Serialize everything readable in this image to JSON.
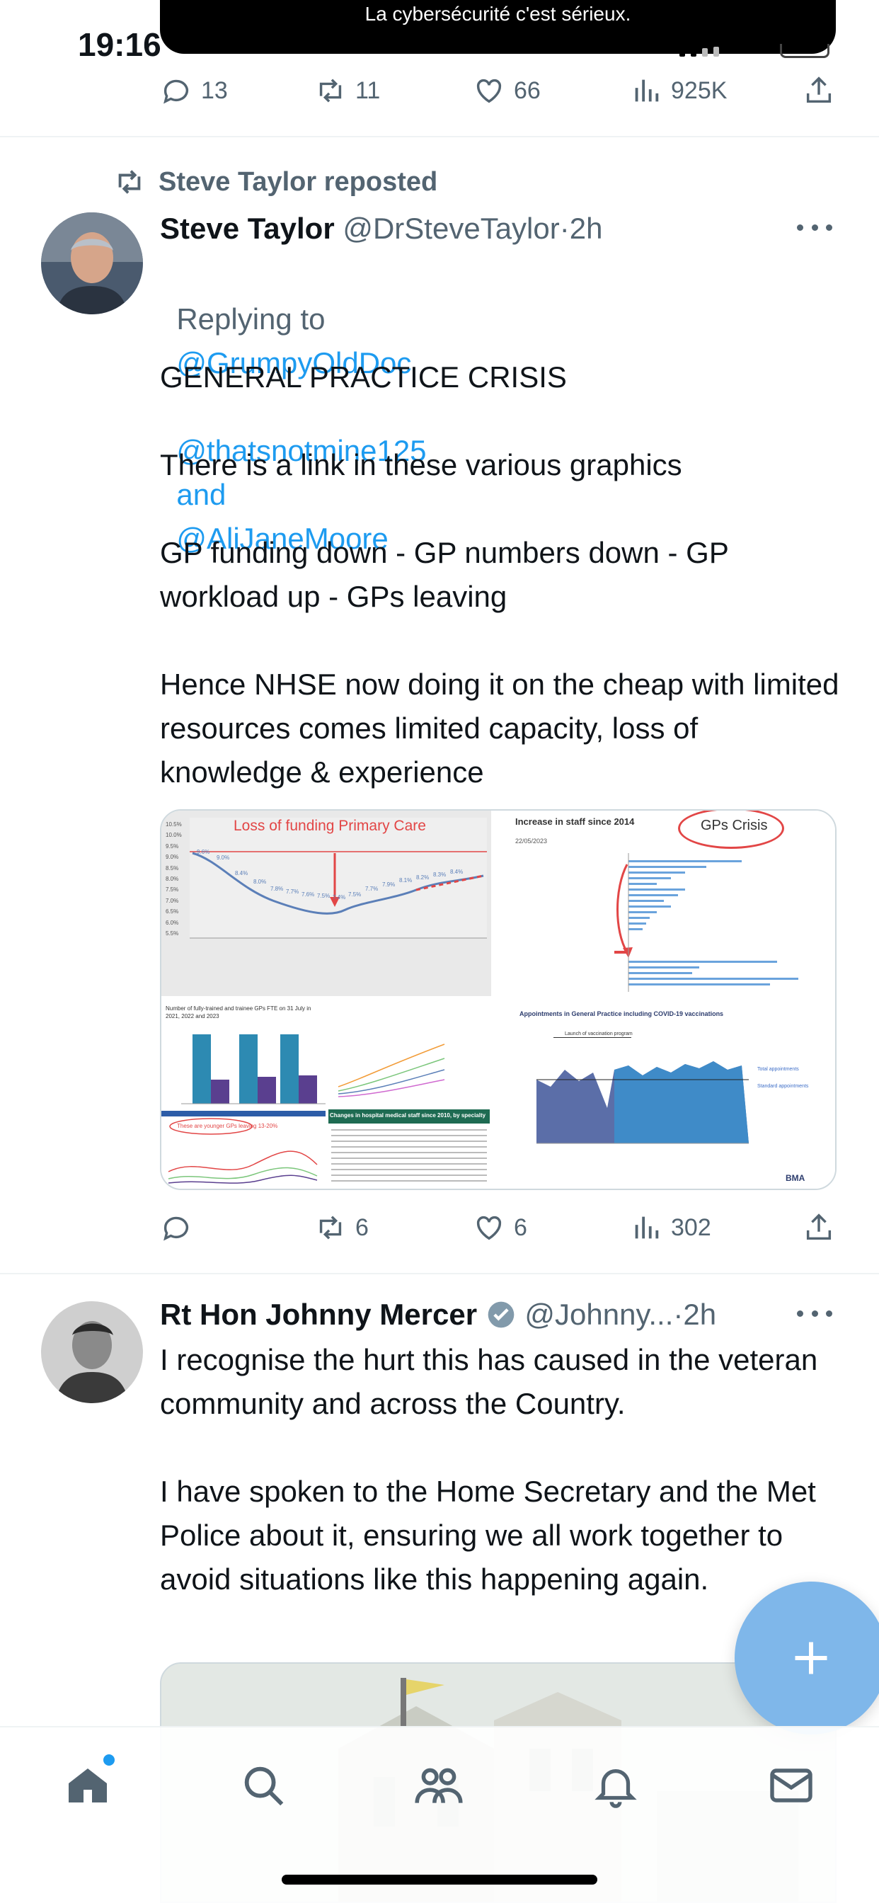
{
  "status": {
    "time": "19:16",
    "notice": "La cybersécurité c'est sérieux."
  },
  "top_actions": {
    "replies": "13",
    "reposts": "11",
    "likes": "66",
    "views": "925K"
  },
  "tweet1": {
    "repost_banner": "Steve Taylor reposted",
    "name": "Steve Taylor",
    "handle": "@DrSteveTaylor",
    "sep": "·",
    "time": "2h",
    "replying_prefix": "Replying to",
    "reply_to_1": "@GrumpyOldDoc",
    "reply_to_2": "@thatsnotmine125",
    "reply_and": "and",
    "reply_to_3": "@AliJaneMoore",
    "text": "GENERAL PRACTICE CRISIS\n\nThere is a link in these various graphics\n\nGP funding down - GP numbers down - GP workload up - GPs leaving\n\nHence NHSE now doing it on the cheap with limited resources comes limited capacity, loss of knowledge & experience",
    "images": {
      "funding_title": "Loss of funding Primary Care",
      "staff_title": "Increase in staff since 2014",
      "crisis_label": "GPs Crisis",
      "staff_date": "22/05/2023",
      "trained_title": "Number of fully-trained and trainee GPs FTE on 31 July in 2021, 2022 and 2023",
      "leaving_label": "These are younger GPs leaving 13-20%",
      "changes_title": "Changes in hospital medical staff since 2010, by specialty",
      "appointments_title": "Appointments in General Practice including COVID-19 vaccinations",
      "launch_label": "Launch of vaccination program",
      "total_label": "Total appointments",
      "standard_label": "Standard appointments",
      "bma_label": "BMA",
      "y_ticks": [
        "10.5%",
        "10.0%",
        "9.5%",
        "9.0%",
        "8.5%",
        "8.0%",
        "7.5%",
        "7.0%",
        "6.5%",
        "6.0%",
        "5.5%"
      ],
      "point_labels": [
        "9.6%",
        "9.0%",
        "8.4%",
        "8.0%",
        "7.8%",
        "7.7%",
        "7.6%",
        "7.5%",
        "7.4%",
        "7.5%",
        "7.7%",
        "7.9%",
        "8.1%",
        "8.2%",
        "8.3%",
        "8.4%"
      ]
    },
    "actions": {
      "replies": "",
      "reposts": "6",
      "likes": "6",
      "views": "302"
    }
  },
  "tweet2": {
    "name": "Rt Hon Johnny Mercer",
    "handle": "@Johnny...",
    "sep": "·",
    "time": "2h",
    "text": "I recognise the hurt this has caused in the veteran community and across the Country.\n\nI have spoken to the Home Secretary and the Met Police about it, ensuring we all work together to avoid situations like this happening again."
  },
  "tabs": [
    "home-icon",
    "search-icon",
    "communities-icon",
    "notifications-icon",
    "messages-icon"
  ],
  "colors": {
    "accent": "#1d9bf0",
    "muted": "#536471",
    "fab": "#7fb7ea"
  }
}
